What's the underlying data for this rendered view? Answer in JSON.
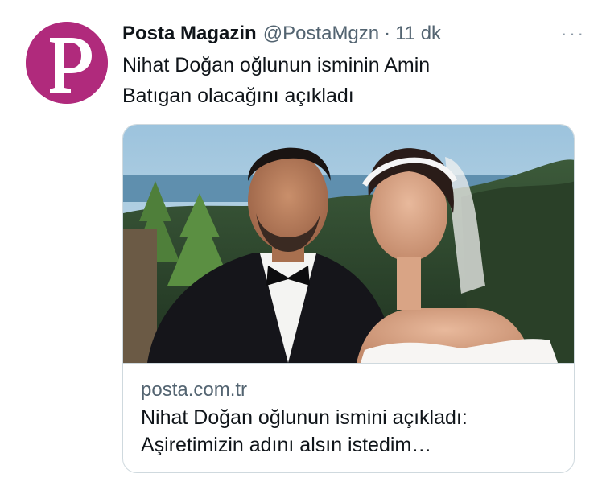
{
  "tweet": {
    "author_name": "Posta Magazin",
    "author_handle": "@PostaMgzn",
    "separator": "·",
    "time": "11 dk",
    "more_label": "···",
    "avatar_logo_letter": "P",
    "text_line1": "Nihat Doğan oğlunun isminin Amin",
    "text_line2": "Batıgan olacağını açıkladı"
  },
  "card": {
    "domain": "posta.com.tr",
    "title_line1": "Nihat Doğan oğlunun ismini açıkladı:",
    "title_line2": "Aşiretimizin adını alsın istedim…",
    "image_subject": "wedding-photo-couple"
  },
  "colors": {
    "brand": "#b02a7c",
    "text_primary": "#0f1419",
    "text_secondary": "#536471",
    "border": "#cfd9de"
  }
}
